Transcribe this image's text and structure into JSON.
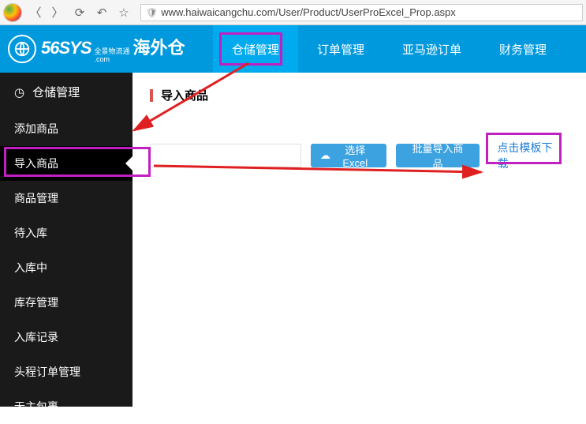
{
  "browser": {
    "url": "www.haiwaicangchu.com/User/Product/UserProExcel_Prop.aspx"
  },
  "logo": {
    "main": "56SYS",
    "dotcom": ".com",
    "sub1": "全景物流通",
    "cn": "海外仓"
  },
  "nav": {
    "items": [
      {
        "label": "仓储管理",
        "active": true
      },
      {
        "label": "订单管理",
        "active": false
      },
      {
        "label": "亚马逊订单",
        "active": false
      },
      {
        "label": "财务管理",
        "active": false
      }
    ]
  },
  "sidebar": {
    "header": "仓储管理",
    "items": [
      "添加商品",
      "导入商品",
      "商品管理",
      "待入库",
      "入库中",
      "库存管理",
      "入库记录",
      "头程订单管理",
      "无主包裹"
    ],
    "activeIndex": 1
  },
  "main": {
    "crumb": "导入商品",
    "choose_excel": "选择Excel",
    "bulk_import": "批量导入商品",
    "download_tpl": "点击模板下载"
  }
}
